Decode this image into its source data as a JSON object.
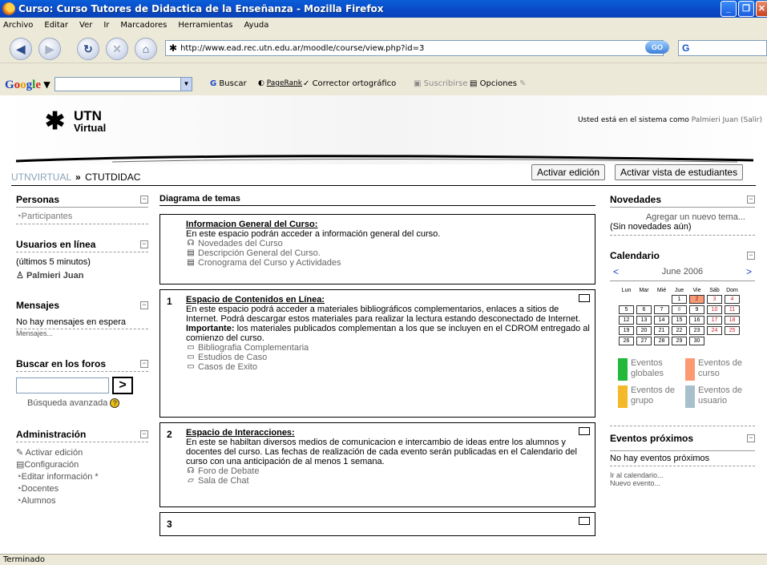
{
  "window": {
    "title": "Curso: Curso Tutores de Didactica de la Enseñanza - Mozilla Firefox"
  },
  "menu": [
    "Archivo",
    "Editar",
    "Ver",
    "Ir",
    "Marcadores",
    "Herramientas",
    "Ayuda"
  ],
  "navbar": {
    "url": "http://www.ead.rec.utn.edu.ar/moodle/course/view.php?id=3",
    "go_label": "GO",
    "search_logo": "G"
  },
  "google_toolbar": {
    "logo": "Google",
    "buscar": "Buscar",
    "pagerank": "PageRank",
    "corrector": "Corrector ortográfico",
    "suscribirse": "Suscribirse",
    "opciones": "Opciones"
  },
  "header": {
    "logo_top": "UTN",
    "logo_bottom": "Virtual",
    "login_prefix": "Usted está en el sistema como",
    "login_name": "Palmieri Juan",
    "login_action": "(Salir)"
  },
  "breadcrumb": {
    "home": "UTNVIRTUAL",
    "separator": "»",
    "current": "CTUTDIDAC"
  },
  "buttons": {
    "edit": "Activar edición",
    "student_view": "Activar vista de estudiantes"
  },
  "left": {
    "personas": {
      "title": "Personas",
      "item": "Participantes"
    },
    "usuarios": {
      "title": "Usuarios en línea",
      "note": "(últimos 5 minutos)",
      "user": "Palmieri Juan"
    },
    "mensajes": {
      "title": "Mensajes",
      "text": "No hay mensajes en espera",
      "link": "Mensajes..."
    },
    "foros": {
      "title": "Buscar en los foros",
      "go": ">",
      "advanced": "Búsqueda avanzada"
    },
    "admin": {
      "title": "Administración",
      "items": [
        "Activar edición",
        "Configuración",
        "Editar información *",
        "Docentes",
        "Alumnos"
      ]
    }
  },
  "center": {
    "heading": "Diagrama de temas",
    "sections": [
      {
        "num": "",
        "title": "Informacion General del Curso:",
        "text": "En este espacio podrán acceder a información general del curso.",
        "resources": [
          "Novedades del Curso",
          "Descripción General del Curso.",
          "Cronograma del Curso y Actividades"
        ]
      },
      {
        "num": "1",
        "title": "Espacio de Contenidos en Línea:",
        "text": "En este espacio podrá acceder a materiales bibliográficos complementarios, enlaces a sitios de Internet. Podrá descargar estos materiales para realizar la lectura estando desconectado de Internet.",
        "important_label": "Importante:",
        "important_text": "los materiales publicados complementan a los que se incluyen en el CDROM entregado al comienzo del curso.",
        "resources": [
          "Bibliografia Complementaria",
          "Estudios de Caso",
          "Casos de Exito"
        ]
      },
      {
        "num": "2",
        "title": "Espacio de Interacciones:",
        "text": "En este se habiltan diversos medios de comunicacion e intercambio de ideas entre los alumnos y docentes del curso. Las fechas de realización de cada evento serán publicadas en el Calendario del curso con una anticipación de al menos 1 semana.",
        "resources": [
          "Foro de Debate",
          "Sala de Chat"
        ]
      },
      {
        "num": "3"
      }
    ]
  },
  "right": {
    "novedades": {
      "title": "Novedades",
      "add": "Agregar un nuevo tema...",
      "none": "(Sin novedades aún)"
    },
    "calendario": {
      "title": "Calendario",
      "prev": "<",
      "next": ">",
      "month": "June 2006",
      "days": [
        "Lun",
        "Mar",
        "Mié",
        "Jue",
        "Vie",
        "Sáb",
        "Dom"
      ],
      "weeks": [
        [
          "",
          "",
          "",
          "1",
          "2",
          "3",
          "4"
        ],
        [
          "5",
          "6",
          "7",
          "8",
          "9",
          "10",
          "11"
        ],
        [
          "12",
          "13",
          "14",
          "15",
          "16",
          "17",
          "18"
        ],
        [
          "19",
          "20",
          "21",
          "22",
          "23",
          "24",
          "25"
        ],
        [
          "26",
          "27",
          "28",
          "29",
          "30",
          "",
          ""
        ]
      ],
      "legend": [
        {
          "label": "Eventos globales",
          "color": "#22b83a"
        },
        {
          "label": "Eventos de curso",
          "color": "#fb9a72"
        },
        {
          "label": "Eventos de grupo",
          "color": "#f4b928"
        },
        {
          "label": "Eventos de usuario",
          "color": "#a8c0cc"
        }
      ]
    },
    "proximos": {
      "title": "Eventos próximos",
      "none": "No hay eventos próximos",
      "link1": "Ir al calendario...",
      "link2": "Nuevo evento..."
    }
  },
  "status": "Terminado"
}
